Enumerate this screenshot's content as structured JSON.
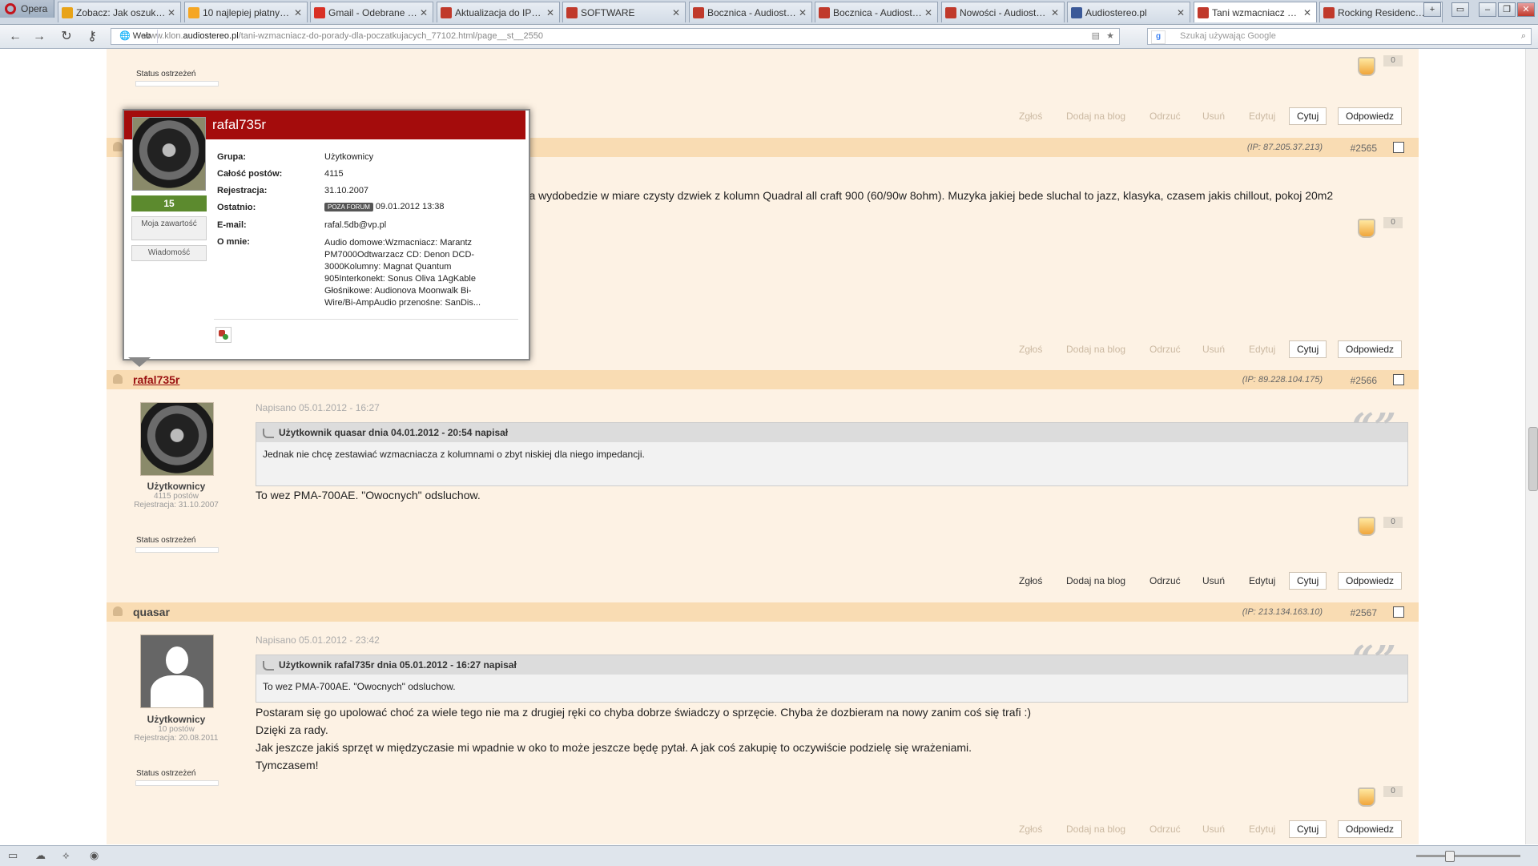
{
  "browser": {
    "opera_label": "Opera",
    "tabs": [
      {
        "label": "Zobacz: Jak oszukują...",
        "color": "#e8a317"
      },
      {
        "label": "10 najlepiej płatnych...",
        "color": "#f5a623"
      },
      {
        "label": "Gmail - Odebrane - d...",
        "color": "#d93025"
      },
      {
        "label": "Aktualizacja do IPBo...",
        "color": "#c0392b"
      },
      {
        "label": "SOFTWARE",
        "color": "#c0392b"
      },
      {
        "label": "Bocznica - Audioster...",
        "color": "#c0392b"
      },
      {
        "label": "Bocznica - Audioster...",
        "color": "#c0392b"
      },
      {
        "label": "Nowości - Audiostere...",
        "color": "#c0392b"
      },
      {
        "label": "Audiostereo.pl",
        "color": "#3b5998"
      },
      {
        "label": "Tani wzmacniacz do ...",
        "color": "#c0392b"
      },
      {
        "label": "Rocking Residence B...",
        "color": "#c0392b"
      }
    ],
    "web_label": "Web",
    "url_prefix": "www.klon.",
    "url_host": "audiostereo.pl",
    "url_path": "/tani-wzmacniacz-do-porady-dla-poczatkujacych_77102.html/page__st__2550",
    "search_placeholder": "Szukaj używając Google"
  },
  "top_post": {
    "warn_label": "Status ostrzeżeń",
    "rep_count": "0",
    "actions": [
      "Zgłoś",
      "Dodaj na blog",
      "Odrzuć",
      "Usuń",
      "Edytuj"
    ],
    "quote_btn": "Cytuj",
    "reply_btn": "Odpowiedz"
  },
  "post_2565": {
    "ip": "(IP: 87.205.37.213)",
    "num": "#2565",
    "text_fragment": "bra wydobedzie w miare czysty dzwiek z kolumn Quadral all craft 900 (60/90w 8ohm). Muzyka jakiej bede sluchal to jazz, klasyka, czasem jakis chillout, pokoj 20m2",
    "rep_count": "0",
    "actions": [
      "Zgłoś",
      "Dodaj na blog",
      "Odrzuć",
      "Usuń",
      "Edytuj"
    ],
    "quote_btn": "Cytuj",
    "reply_btn": "Odpowiedz"
  },
  "popup": {
    "username": "rafal735r",
    "reputation": "15",
    "my_content_btn": "Moja zawartość",
    "message_btn": "Wiadomość",
    "rows": [
      {
        "label": "Grupa:",
        "value": "Użytkownicy"
      },
      {
        "label": "Całość postów:",
        "value": "4115"
      },
      {
        "label": "Rejestracja:",
        "value": "31.10.2007"
      },
      {
        "label": "Ostatnio:",
        "value": "09.01.2012 13:38"
      },
      {
        "label": "E-mail:",
        "value": "rafal.5db@vp.pl"
      },
      {
        "label": "O mnie:",
        "value": "Audio domowe:Wzmacniacz: Marantz PM7000Odtwarzacz CD: Denon DCD-3000Kolumny: Magnat Quantum 905Interkonekt: Sonus Oliva 1AgKable Głośnikowe: Audionova Moonwalk Bi-Wire/Bi-AmpAudio przenośne: SanDis..."
      }
    ],
    "offline_badge": "POZA FORUM"
  },
  "post_2566": {
    "username": "rafal735r",
    "ip": "(IP: 89.228.104.175)",
    "num": "#2566",
    "group": "Użytkownicy",
    "posts": "4115 postów",
    "registered": "Rejestracja: 31.10.2007",
    "warn_label": "Status ostrzeżeń",
    "written": "Napisano 05.01.2012 - 16:27",
    "quote_head": "Użytkownik quasar dnia 04.01.2012 - 20:54 napisał",
    "quote_body": "Jednak nie chcę zestawiać wzmacniacza z kolumnami o zbyt niskiej dla niego impedancji.",
    "text": "To wez PMA-700AE. \"Owocnych\" odsluchow.",
    "rep_count": "0",
    "actions": [
      "Zgłoś",
      "Dodaj na blog",
      "Odrzuć",
      "Usuń",
      "Edytuj"
    ],
    "quote_btn": "Cytuj",
    "reply_btn": "Odpowiedz"
  },
  "post_2567": {
    "username": "quasar",
    "ip": "(IP: 213.134.163.10)",
    "num": "#2567",
    "group": "Użytkownicy",
    "posts": "10 postów",
    "registered": "Rejestracja: 20.08.2011",
    "warn_label": "Status ostrzeżeń",
    "written": "Napisano 05.01.2012 - 23:42",
    "quote_head": "Użytkownik rafal735r dnia 05.01.2012 - 16:27 napisał",
    "quote_body": "To wez PMA-700AE. \"Owocnych\" odsluchow.",
    "lines": [
      "Postaram się go upolować choć za wiele tego nie ma z drugiej ręki co chyba dobrze świadczy o sprzęcie. Chyba że dozbieram na nowy zanim coś się trafi :)",
      "Dzięki za rady.",
      "Jak jeszcze jakiś sprzęt w międzyczasie mi wpadnie w oko to może jeszcze będę pytał. A jak coś zakupię to oczywiście podzielę się wrażeniami.",
      "Tymczasem!"
    ],
    "rep_count": "0",
    "actions": [
      "Zgłoś",
      "Dodaj na blog",
      "Odrzuć",
      "Usuń",
      "Edytuj"
    ],
    "quote_btn": "Cytuj",
    "reply_btn": "Odpowiedz"
  }
}
